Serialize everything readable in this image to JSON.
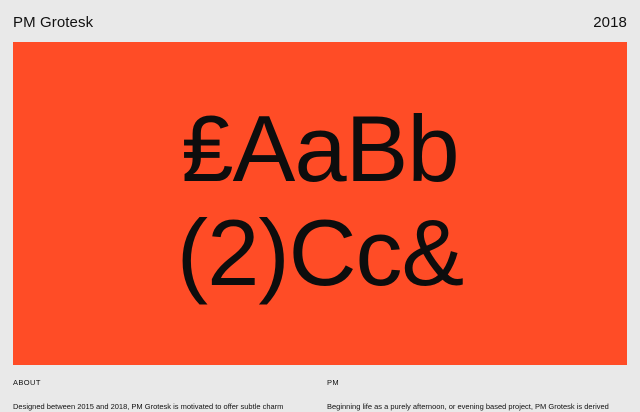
{
  "header": {
    "title": "PM Grotesk",
    "year": "2018"
  },
  "hero": {
    "line1": "₤AaBb",
    "line2": "(2)Cc&",
    "background_color": "#ff4c26"
  },
  "about": {
    "heading": "ABOUT",
    "text": "Designed between 2015 and 2018, PM Grotesk is motivated to offer subtle charm"
  },
  "pm": {
    "heading": "PM",
    "text": "Beginning life as a purely afternoon, or evening based project, PM Grotesk is derived"
  }
}
